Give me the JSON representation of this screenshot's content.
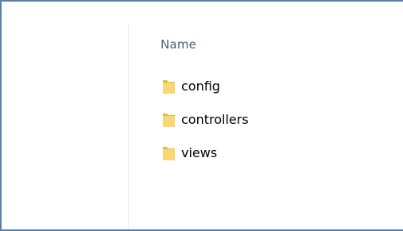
{
  "explorer": {
    "column_header": "Name",
    "items": [
      {
        "label": "config",
        "icon": "folder-icon"
      },
      {
        "label": "controllers",
        "icon": "folder-icon"
      },
      {
        "label": "views",
        "icon": "folder-icon"
      }
    ]
  },
  "colors": {
    "folder_fill": "#f8d775",
    "folder_shade": "#e8b93f",
    "header_text": "#4c607a",
    "window_border": "#5a7fa8"
  }
}
